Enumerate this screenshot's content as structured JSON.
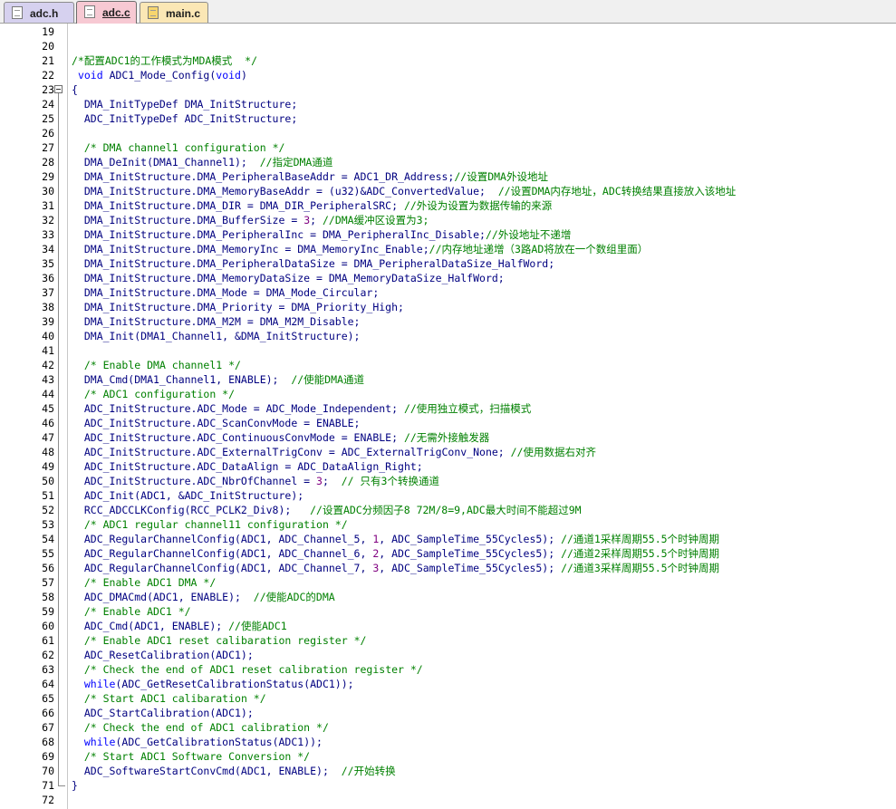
{
  "tabs": [
    {
      "label": "adc.h"
    },
    {
      "label": "adc.c"
    },
    {
      "label": "main.c"
    }
  ],
  "lines": [
    {
      "n": "19",
      "seg": []
    },
    {
      "n": "20",
      "seg": []
    },
    {
      "n": "21",
      "seg": [
        {
          "t": "/*配置ADC1的工作模式为MDA模式  */",
          "c": "cmt"
        }
      ]
    },
    {
      "n": "22",
      "seg": [
        {
          "t": " ",
          "c": ""
        },
        {
          "t": "void",
          "c": "kw"
        },
        {
          "t": " ADC1_Mode_Config(",
          "c": ""
        },
        {
          "t": "void",
          "c": "kw"
        },
        {
          "t": ")",
          "c": ""
        }
      ]
    },
    {
      "n": "23",
      "seg": [
        {
          "t": "{",
          "c": ""
        }
      ]
    },
    {
      "n": "24",
      "seg": [
        {
          "t": "  DMA_InitTypeDef DMA_InitStructure;",
          "c": ""
        }
      ]
    },
    {
      "n": "25",
      "seg": [
        {
          "t": "  ADC_InitTypeDef ADC_InitStructure;",
          "c": ""
        }
      ]
    },
    {
      "n": "26",
      "seg": []
    },
    {
      "n": "27",
      "seg": [
        {
          "t": "  ",
          "c": ""
        },
        {
          "t": "/* DMA channel1 configuration */",
          "c": "cmt"
        }
      ]
    },
    {
      "n": "28",
      "seg": [
        {
          "t": "  DMA_DeInit(DMA1_Channel1);  ",
          "c": ""
        },
        {
          "t": "//指定DMA通道",
          "c": "cmt"
        }
      ]
    },
    {
      "n": "29",
      "seg": [
        {
          "t": "  DMA_InitStructure.DMA_PeripheralBaseAddr = ADC1_DR_Address;",
          "c": ""
        },
        {
          "t": "//设置DMA外设地址",
          "c": "cmt"
        }
      ]
    },
    {
      "n": "30",
      "seg": [
        {
          "t": "  DMA_InitStructure.DMA_MemoryBaseAddr = (u32)&ADC_ConvertedValue;  ",
          "c": ""
        },
        {
          "t": "//设置DMA内存地址，ADC转换结果直接放入该地址",
          "c": "cmt"
        }
      ]
    },
    {
      "n": "31",
      "seg": [
        {
          "t": "  DMA_InitStructure.DMA_DIR = DMA_DIR_PeripheralSRC; ",
          "c": ""
        },
        {
          "t": "//外设为设置为数据传输的来源",
          "c": "cmt"
        }
      ]
    },
    {
      "n": "32",
      "seg": [
        {
          "t": "  DMA_InitStructure.DMA_BufferSize = ",
          "c": ""
        },
        {
          "t": "3",
          "c": "num"
        },
        {
          "t": "; ",
          "c": ""
        },
        {
          "t": "//DMA缓冲区设置为3;",
          "c": "cmt"
        }
      ]
    },
    {
      "n": "33",
      "seg": [
        {
          "t": "  DMA_InitStructure.DMA_PeripheralInc = DMA_PeripheralInc_Disable;",
          "c": ""
        },
        {
          "t": "//外设地址不递增",
          "c": "cmt"
        }
      ]
    },
    {
      "n": "34",
      "seg": [
        {
          "t": "  DMA_InitStructure.DMA_MemoryInc = DMA_MemoryInc_Enable;",
          "c": ""
        },
        {
          "t": "//内存地址递增（3路AD将放在一个数组里面）",
          "c": "cmt"
        }
      ]
    },
    {
      "n": "35",
      "seg": [
        {
          "t": "  DMA_InitStructure.DMA_PeripheralDataSize = DMA_PeripheralDataSize_HalfWord;",
          "c": ""
        }
      ]
    },
    {
      "n": "36",
      "seg": [
        {
          "t": "  DMA_InitStructure.DMA_MemoryDataSize = DMA_MemoryDataSize_HalfWord;",
          "c": ""
        }
      ]
    },
    {
      "n": "37",
      "seg": [
        {
          "t": "  DMA_InitStructure.DMA_Mode = DMA_Mode_Circular;",
          "c": ""
        }
      ]
    },
    {
      "n": "38",
      "seg": [
        {
          "t": "  DMA_InitStructure.DMA_Priority = DMA_Priority_High;",
          "c": ""
        }
      ]
    },
    {
      "n": "39",
      "seg": [
        {
          "t": "  DMA_InitStructure.DMA_M2M = DMA_M2M_Disable;",
          "c": ""
        }
      ]
    },
    {
      "n": "40",
      "seg": [
        {
          "t": "  DMA_Init(DMA1_Channel1, &DMA_InitStructure);",
          "c": ""
        }
      ]
    },
    {
      "n": "41",
      "seg": []
    },
    {
      "n": "42",
      "seg": [
        {
          "t": "  ",
          "c": ""
        },
        {
          "t": "/* Enable DMA channel1 */",
          "c": "cmt"
        }
      ]
    },
    {
      "n": "43",
      "seg": [
        {
          "t": "  DMA_Cmd(DMA1_Channel1, ENABLE);  ",
          "c": ""
        },
        {
          "t": "//使能DMA通道",
          "c": "cmt"
        }
      ]
    },
    {
      "n": "44",
      "seg": [
        {
          "t": "  ",
          "c": ""
        },
        {
          "t": "/* ADC1 configuration */",
          "c": "cmt"
        }
      ]
    },
    {
      "n": "45",
      "seg": [
        {
          "t": "  ADC_InitStructure.ADC_Mode = ADC_Mode_Independent; ",
          "c": ""
        },
        {
          "t": "//使用独立模式，扫描模式",
          "c": "cmt"
        }
      ]
    },
    {
      "n": "46",
      "seg": [
        {
          "t": "  ADC_InitStructure.ADC_ScanConvMode = ENABLE;",
          "c": ""
        }
      ]
    },
    {
      "n": "47",
      "seg": [
        {
          "t": "  ADC_InitStructure.ADC_ContinuousConvMode = ENABLE; ",
          "c": ""
        },
        {
          "t": "//无需外接触发器",
          "c": "cmt"
        }
      ]
    },
    {
      "n": "48",
      "seg": [
        {
          "t": "  ADC_InitStructure.ADC_ExternalTrigConv = ADC_ExternalTrigConv_None; ",
          "c": ""
        },
        {
          "t": "//使用数据右对齐",
          "c": "cmt"
        }
      ]
    },
    {
      "n": "49",
      "seg": [
        {
          "t": "  ADC_InitStructure.ADC_DataAlign = ADC_DataAlign_Right;",
          "c": ""
        }
      ]
    },
    {
      "n": "50",
      "seg": [
        {
          "t": "  ADC_InitStructure.ADC_NbrOfChannel = ",
          "c": ""
        },
        {
          "t": "3",
          "c": "num"
        },
        {
          "t": ";  ",
          "c": ""
        },
        {
          "t": "// 只有3个转换通道",
          "c": "cmt"
        }
      ]
    },
    {
      "n": "51",
      "seg": [
        {
          "t": "  ADC_Init(ADC1, &ADC_InitStructure);",
          "c": ""
        }
      ]
    },
    {
      "n": "52",
      "seg": [
        {
          "t": "  RCC_ADCCLKConfig(RCC_PCLK2_Div8);   ",
          "c": ""
        },
        {
          "t": "//设置ADC分频因子8 72M/8=9,ADC最大时间不能超过9M",
          "c": "cmt"
        }
      ]
    },
    {
      "n": "53",
      "seg": [
        {
          "t": "  ",
          "c": ""
        },
        {
          "t": "/* ADC1 regular channel11 configuration */",
          "c": "cmt"
        }
      ]
    },
    {
      "n": "54",
      "seg": [
        {
          "t": "  ADC_RegularChannelConfig(ADC1, ADC_Channel_5, ",
          "c": ""
        },
        {
          "t": "1",
          "c": "num"
        },
        {
          "t": ", ADC_SampleTime_55Cycles5); ",
          "c": ""
        },
        {
          "t": "//通道1采样周期55.5个时钟周期",
          "c": "cmt"
        }
      ]
    },
    {
      "n": "55",
      "seg": [
        {
          "t": "  ADC_RegularChannelConfig(ADC1, ADC_Channel_6, ",
          "c": ""
        },
        {
          "t": "2",
          "c": "num"
        },
        {
          "t": ", ADC_SampleTime_55Cycles5); ",
          "c": ""
        },
        {
          "t": "//通道2采样周期55.5个时钟周期",
          "c": "cmt"
        }
      ]
    },
    {
      "n": "56",
      "seg": [
        {
          "t": "  ADC_RegularChannelConfig(ADC1, ADC_Channel_7, ",
          "c": ""
        },
        {
          "t": "3",
          "c": "num"
        },
        {
          "t": ", ADC_SampleTime_55Cycles5); ",
          "c": ""
        },
        {
          "t": "//通道3采样周期55.5个时钟周期",
          "c": "cmt"
        }
      ]
    },
    {
      "n": "57",
      "seg": [
        {
          "t": "  ",
          "c": ""
        },
        {
          "t": "/* Enable ADC1 DMA */",
          "c": "cmt"
        }
      ]
    },
    {
      "n": "58",
      "seg": [
        {
          "t": "  ADC_DMACmd(ADC1, ENABLE);  ",
          "c": ""
        },
        {
          "t": "//使能ADC的DMA",
          "c": "cmt"
        }
      ]
    },
    {
      "n": "59",
      "seg": [
        {
          "t": "  ",
          "c": ""
        },
        {
          "t": "/* Enable ADC1 */",
          "c": "cmt"
        }
      ]
    },
    {
      "n": "60",
      "seg": [
        {
          "t": "  ADC_Cmd(ADC1, ENABLE); ",
          "c": ""
        },
        {
          "t": "//使能ADC1",
          "c": "cmt"
        }
      ]
    },
    {
      "n": "61",
      "seg": [
        {
          "t": "  ",
          "c": ""
        },
        {
          "t": "/* Enable ADC1 reset calibaration register */",
          "c": "cmt"
        }
      ]
    },
    {
      "n": "62",
      "seg": [
        {
          "t": "  ADC_ResetCalibration(ADC1);",
          "c": ""
        }
      ]
    },
    {
      "n": "63",
      "seg": [
        {
          "t": "  ",
          "c": ""
        },
        {
          "t": "/* Check the end of ADC1 reset calibration register */",
          "c": "cmt"
        }
      ]
    },
    {
      "n": "64",
      "seg": [
        {
          "t": "  ",
          "c": ""
        },
        {
          "t": "while",
          "c": "kw"
        },
        {
          "t": "(ADC_GetResetCalibrationStatus(ADC1));",
          "c": ""
        }
      ]
    },
    {
      "n": "65",
      "seg": [
        {
          "t": "  ",
          "c": ""
        },
        {
          "t": "/* Start ADC1 calibaration */",
          "c": "cmt"
        }
      ]
    },
    {
      "n": "66",
      "seg": [
        {
          "t": "  ADC_StartCalibration(ADC1);",
          "c": ""
        }
      ]
    },
    {
      "n": "67",
      "seg": [
        {
          "t": "  ",
          "c": ""
        },
        {
          "t": "/* Check the end of ADC1 calibration */",
          "c": "cmt"
        }
      ]
    },
    {
      "n": "68",
      "seg": [
        {
          "t": "  ",
          "c": ""
        },
        {
          "t": "while",
          "c": "kw"
        },
        {
          "t": "(ADC_GetCalibrationStatus(ADC1));",
          "c": ""
        }
      ]
    },
    {
      "n": "69",
      "seg": [
        {
          "t": "  ",
          "c": ""
        },
        {
          "t": "/* Start ADC1 Software Conversion */",
          "c": "cmt"
        }
      ]
    },
    {
      "n": "70",
      "seg": [
        {
          "t": "  ADC_SoftwareStartConvCmd(ADC1, ENABLE);  ",
          "c": ""
        },
        {
          "t": "//开始转换",
          "c": "cmt"
        }
      ]
    },
    {
      "n": "71",
      "seg": [
        {
          "t": "}",
          "c": ""
        }
      ]
    },
    {
      "n": "72",
      "seg": []
    }
  ]
}
